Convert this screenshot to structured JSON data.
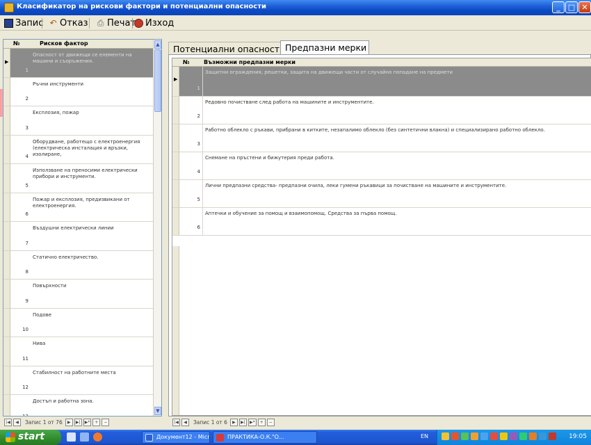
{
  "window": {
    "title": "Класификатор на рискови фактори и потенциални опасности",
    "buttons": {
      "minimize": "_",
      "maximize": "□",
      "close": "✕"
    }
  },
  "toolbar": {
    "save_label": "Запис",
    "cancel_label": "Отказ",
    "print_label": "Печат",
    "exit_label": "Изход"
  },
  "left_grid": {
    "headers": {
      "num": "№",
      "factor": "Рисков фактор"
    },
    "rows": [
      {
        "num": "1",
        "text": "Опасност от движещи се елементи на машини и съоръжения."
      },
      {
        "num": "2",
        "text": "Ръчни инструменти"
      },
      {
        "num": "3",
        "text": "Експлозия, пожар"
      },
      {
        "num": "4",
        "text": "Оборудване, работещо с електроенергия (електрическа инсталация и връзки, изолиране,"
      },
      {
        "num": "5",
        "text": "Използване на преносими електрически прибори и инструменти."
      },
      {
        "num": "6",
        "text": "Пожар и експлозия, предизвикани от електроенергия."
      },
      {
        "num": "7",
        "text": "Въздушни електрически линии"
      },
      {
        "num": "8",
        "text": "Статично електричество."
      },
      {
        "num": "9",
        "text": "Повърхности"
      },
      {
        "num": "10",
        "text": "Подове"
      },
      {
        "num": "11",
        "text": "Нива"
      },
      {
        "num": "12",
        "text": "Стабилност на работните места"
      },
      {
        "num": "13",
        "text": "Достъп и работна зона."
      }
    ],
    "nav": {
      "record_label": "Запис 1 от 76"
    }
  },
  "tabs": [
    {
      "label": "Потенциални опасности"
    },
    {
      "label": "Предпазни мерки"
    }
  ],
  "right_grid": {
    "headers": {
      "num": "№",
      "measure": "Възможни предпазни мерки"
    },
    "rows": [
      {
        "num": "1",
        "text": "Защитни ограждения, решетки, защита на движещи части от случайно попадане на предмети"
      },
      {
        "num": "2",
        "text": "Редовно почистване след работа на машините и инструментите."
      },
      {
        "num": "3",
        "text": "Работно облекло с ръкави, прибрани в китките, незапалимо облекло (без синтетични влакна) и специализирано работно облекло."
      },
      {
        "num": "4",
        "text": "Снемане на пръстени и бижутерия преди работа."
      },
      {
        "num": "5",
        "text": "Лични предпазни средства- предпазни очила, леки гумени ръкавици за почистване на машините и инструментите."
      },
      {
        "num": "6",
        "text": "Аптечки и обучение за помощ и взаимопомощ. Средства за първа помощ."
      }
    ],
    "nav": {
      "record_label": "Запис 1 от 6"
    }
  },
  "taskbar": {
    "start_label": "start",
    "tasks": [
      {
        "label": "Документ12 - Micros..."
      },
      {
        "label": "ПРАКТИКА-О.К.\"О..."
      }
    ],
    "lang": "EN",
    "clock": "19:05"
  },
  "colors": {
    "titlebar": "#0b49c4",
    "selected_row": "#8b8b8b",
    "taskbar": "#245edb",
    "start": "#2f8b2b"
  }
}
